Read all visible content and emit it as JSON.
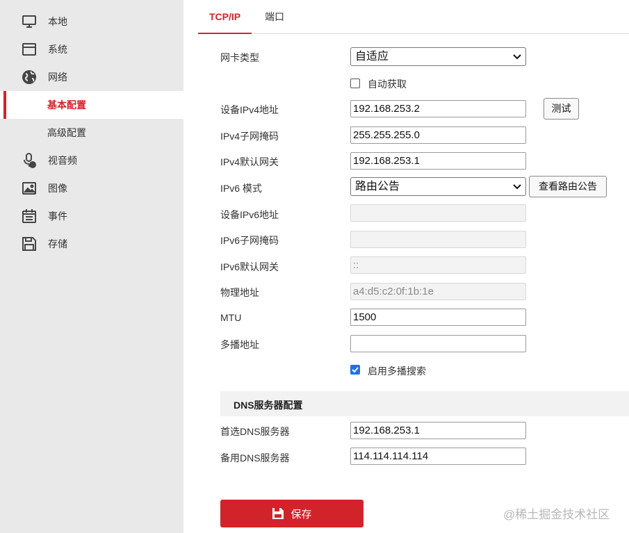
{
  "sidebar": {
    "items": [
      {
        "label": "本地",
        "icon": "monitor-icon"
      },
      {
        "label": "系统",
        "icon": "window-icon"
      },
      {
        "label": "网络",
        "icon": "globe-icon"
      },
      {
        "label": "基本配置",
        "active": true
      },
      {
        "label": "高级配置"
      },
      {
        "label": "视音频",
        "icon": "microphone-icon"
      },
      {
        "label": "图像",
        "icon": "image-icon"
      },
      {
        "label": "事件",
        "icon": "calendar-icon"
      },
      {
        "label": "存储",
        "icon": "floppy-disk-icon"
      }
    ]
  },
  "tabs": [
    {
      "label": "TCP/IP",
      "active": true
    },
    {
      "label": "端口"
    }
  ],
  "form": {
    "nic_type": {
      "label": "网卡类型",
      "value": "自适应"
    },
    "auto_obtain": {
      "label": "自动获取",
      "checked": false
    },
    "ipv4_address": {
      "label": "设备IPv4地址",
      "value": "192.168.253.2"
    },
    "test_button": "测试",
    "ipv4_mask": {
      "label": "IPv4子网掩码",
      "value": "255.255.255.0"
    },
    "ipv4_gateway": {
      "label": "IPv4默认网关",
      "value": "192.168.253.1"
    },
    "ipv6_mode": {
      "label": "IPv6 模式",
      "value": "路由公告"
    },
    "view_route_button": "查看路由公告",
    "ipv6_address": {
      "label": "设备IPv6地址",
      "value": ""
    },
    "ipv6_mask": {
      "label": "IPv6子网掩码",
      "value": ""
    },
    "ipv6_gateway": {
      "label": "IPv6默认网关",
      "value": "::"
    },
    "mac_address": {
      "label": "物理地址",
      "value": "a4:d5:c2:0f:1b:1e"
    },
    "mtu": {
      "label": "MTU",
      "value": "1500"
    },
    "multicast": {
      "label": "多播地址",
      "value": ""
    },
    "multicast_search": {
      "label": "启用多播搜索",
      "checked": true
    }
  },
  "dns": {
    "section_title": "DNS服务器配置",
    "preferred": {
      "label": "首选DNS服务器",
      "value": "192.168.253.1"
    },
    "alternate": {
      "label": "备用DNS服务器",
      "value": "114.114.114.114"
    }
  },
  "save_button": "保存",
  "watermark": "@稀土掘金技术社区",
  "colors": {
    "accent": "#d2232a",
    "checkbox": "#1a73e8",
    "sidebar_bg": "#e9e9e9"
  }
}
